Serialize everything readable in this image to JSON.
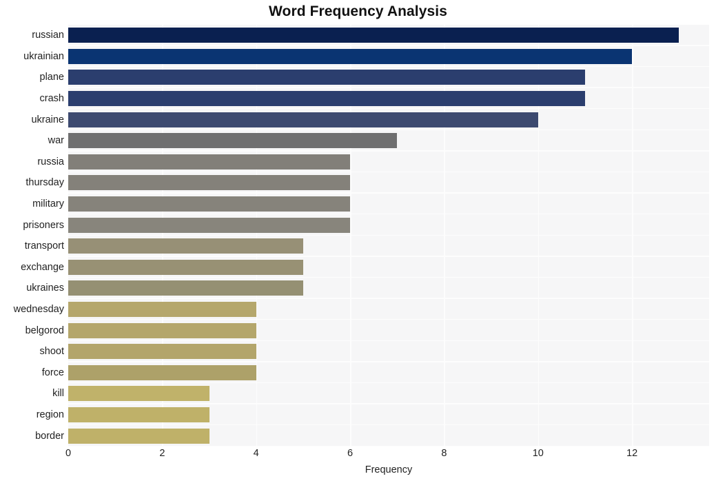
{
  "chart_data": {
    "type": "bar",
    "orientation": "horizontal",
    "title": "Word Frequency Analysis",
    "xlabel": "Frequency",
    "ylabel": "",
    "categories": [
      "russian",
      "ukrainian",
      "plane",
      "crash",
      "ukraine",
      "war",
      "russia",
      "thursday",
      "military",
      "prisoners",
      "transport",
      "exchange",
      "ukraines",
      "wednesday",
      "belgorod",
      "shoot",
      "force",
      "kill",
      "region",
      "border"
    ],
    "values": [
      13,
      12,
      11,
      11,
      10,
      7,
      6,
      6,
      6,
      6,
      5,
      5,
      5,
      4,
      4,
      4,
      4,
      3,
      3,
      3
    ],
    "bar_colors": [
      "#0a2050",
      "#0a3472",
      "#2b3e6e",
      "#2b3e6e",
      "#3d4a70",
      "#6f6f70",
      "#827f79",
      "#84817a",
      "#86837b",
      "#88857c",
      "#979076",
      "#989174",
      "#959073",
      "#b5a76c",
      "#b4a66b",
      "#b3a56b",
      "#ada169",
      "#c0b26a",
      "#bfb169",
      "#bfb169"
    ],
    "xticks": [
      0,
      2,
      4,
      6,
      8,
      10,
      12
    ],
    "xlim": [
      0,
      13.64
    ],
    "grid": true,
    "grid_axis": "x",
    "legend": false,
    "plot_background": "#f6f6f7",
    "page_background": "#ffffff",
    "title_color": "#111111",
    "tick_color": "#222222"
  }
}
